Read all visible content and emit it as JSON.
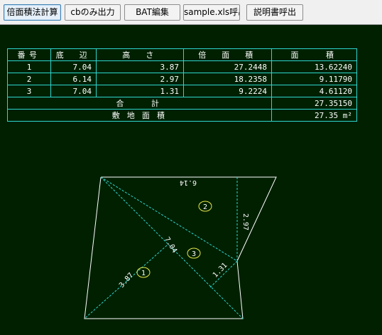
{
  "toolbar": {
    "buttons": [
      {
        "label": "倍面積法計算"
      },
      {
        "label": "cbのみ出力"
      },
      {
        "label": "BAT編集"
      },
      {
        "label": "sample.xls呼出"
      },
      {
        "label": "説明書呼出"
      }
    ]
  },
  "table": {
    "headers": [
      "番号",
      "底　辺",
      "高　さ",
      "倍　面　積",
      "面　　積"
    ],
    "rows": [
      {
        "no": "1",
        "base": "7.04",
        "height": "3.87",
        "double_area": "27.2448",
        "area": "13.62240"
      },
      {
        "no": "2",
        "base": "6.14",
        "height": "2.97",
        "double_area": "18.2358",
        "area": "9.11790"
      },
      {
        "no": "3",
        "base": "7.04",
        "height": "1.31",
        "double_area": "9.2224",
        "area": "4.61120"
      }
    ],
    "total_label": "合　　計",
    "total_value": "27.35150",
    "site_label": "敷 地 面 積",
    "site_value": "27.35 m²"
  },
  "figure": {
    "base_label_top": "6.14",
    "diag_label": "7.04",
    "h1_label": "3.87",
    "h2_label": "2.97",
    "h3_label": "1.31",
    "tri1": "1",
    "tri2": "2",
    "tri3": "3",
    "colors": {
      "line": "#ffffff",
      "dash": "#2fd6d0",
      "ellipse": "#e8e84a",
      "text": "#ffffff"
    }
  }
}
